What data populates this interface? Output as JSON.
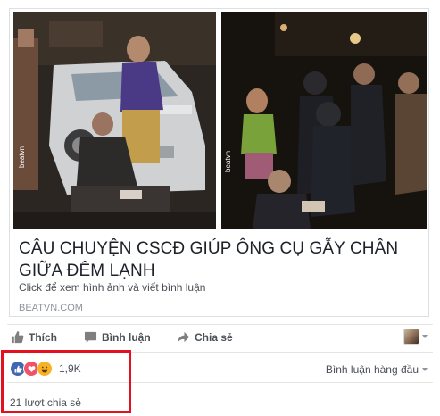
{
  "post": {
    "headline": "CÂU CHUYỆN CSCĐ GIÚP ÔNG CỤ GẪY CHÂN GIỮA ĐÊM LẠNH",
    "description": "Click để xem hình ảnh và viết bình luận",
    "domain": "BEATVN.COM",
    "watermark": "beatvn"
  },
  "actions": {
    "like_label": "Thích",
    "comment_label": "Bình luận",
    "share_label": "Chia sẻ",
    "icons": [
      "thumbs-up-icon",
      "comment-icon",
      "share-arrow-icon"
    ]
  },
  "summary": {
    "reactions": [
      "like",
      "love",
      "haha"
    ],
    "reaction_count": "1,9K",
    "top_comments_label": "Bình luận hàng đầu",
    "share_count": "21 lượt chia sẻ"
  },
  "colors": {
    "like": "#4267b2",
    "love": "#f25268",
    "haha": "#f7b125",
    "highlight": "#e3101e"
  }
}
